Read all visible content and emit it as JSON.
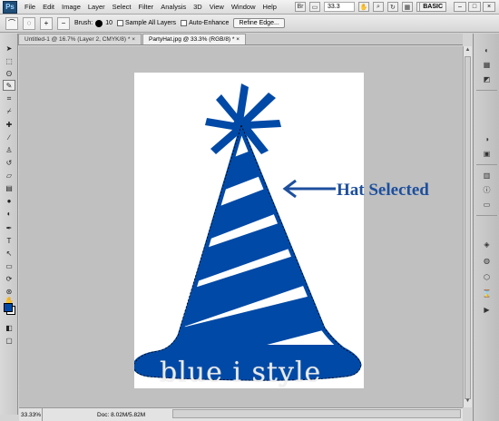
{
  "menubar": {
    "app_logo": "Ps",
    "items": [
      "File",
      "Edit",
      "Image",
      "Layer",
      "Select",
      "Filter",
      "Analysis",
      "3D",
      "View",
      "Window",
      "Help"
    ],
    "zoom": "33.3",
    "workspace": "BASIC",
    "window_controls": [
      "–",
      "□",
      "×"
    ]
  },
  "options_bar": {
    "brush_label": "Brush:",
    "brush_size": "10",
    "sample_all_layers": "Sample All Layers",
    "auto_enhance": "Auto-Enhance",
    "refine_edge": "Refine Edge..."
  },
  "tabs": [
    {
      "label": "Untitled-1 @ 16.7% (Layer 2, CMYK/8) *",
      "close": "×"
    },
    {
      "label": "PartyHat.jpg @ 33.3% (RGB/8) *",
      "close": "×"
    }
  ],
  "statusbar": {
    "zoom": "33.33%",
    "doc": "Doc: 8.02M/5.82M"
  },
  "annotation": {
    "text": "Hat Selected",
    "arrow_color": "#1d4f9d"
  },
  "watermark": "blue i style",
  "colors": {
    "hat_blue": "#0049a6",
    "foreground": "#0049a6",
    "background": "#ffffff"
  },
  "icons": {
    "left_tools": [
      "move-icon",
      "marquee-icon",
      "lasso-icon",
      "quick-selection-icon",
      "crop-icon",
      "eyedropper-icon",
      "healing-icon",
      "brush-icon",
      "clone-stamp-icon",
      "history-brush-icon",
      "eraser-icon",
      "gradient-icon",
      "blur-icon",
      "dodge-icon",
      "pen-icon",
      "type-icon",
      "path-selection-icon",
      "shape-icon",
      "3d-rotate-icon",
      "3d-orbit-icon",
      "hand-icon",
      "zoom-icon"
    ],
    "right_panels": [
      "color-icon",
      "swatches-icon",
      "styles-icon",
      "adjustments-icon",
      "masks-icon",
      "layers-icon",
      "channels-icon",
      "paths-icon"
    ]
  }
}
